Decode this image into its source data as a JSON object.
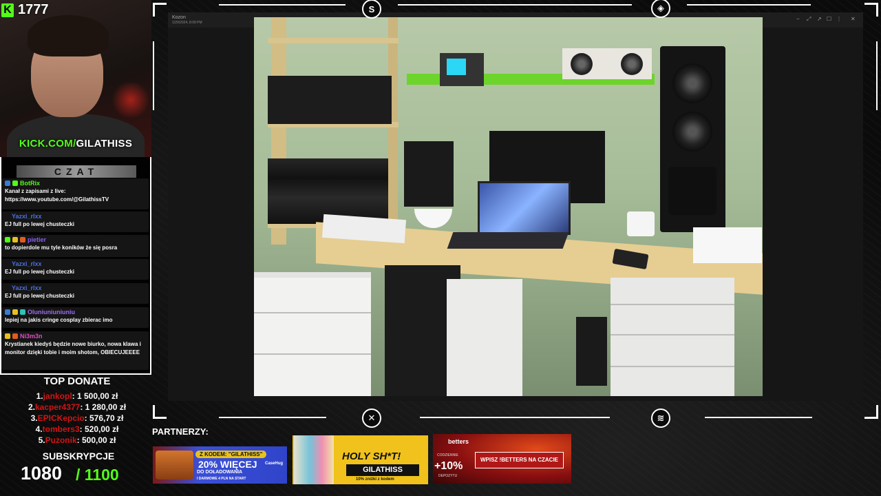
{
  "webcam": {
    "kick_counter": "1777",
    "kick_icon": "K",
    "url_prefix": "KICK.COM/",
    "url_name": "GILATHISS"
  },
  "chat": {
    "title": "CZAT",
    "messages": [
      {
        "user": "BotRix",
        "color": "#53fc18",
        "text": "Kanał z zapisami z live: https://www.youtube.com/@GilathissTV"
      },
      {
        "user": "Yazxi_rlxx",
        "color": "#4a6fe0",
        "text": "EJ full po lewej chusteczki"
      },
      {
        "user": "pietier",
        "color": "#8b5cf6",
        "text": "to dopierdole mu tyle koników że się posra"
      },
      {
        "user": "Yazxi_rlxx",
        "color": "#4a6fe0",
        "text": "EJ full po lewej chusteczki"
      },
      {
        "user": "Yazxi_rlxx",
        "color": "#4a6fe0",
        "text": "EJ full po lewej chusteczki"
      },
      {
        "user": "Oluniuniuniuniu",
        "color": "#9a6cf0",
        "text": "lepiej na jakis cringe cosplay zbierac imo"
      },
      {
        "user": "Ni3m3n",
        "color": "#e04cc0",
        "text": "Krystianek kiedyś będzie nowe biurko, nowa klawa i monitor dzięki tobie i moim shotom, OBIECUJEEEE"
      }
    ]
  },
  "top_donate": {
    "title": "TOP DONATE",
    "entries": [
      {
        "rank": "1.",
        "name": "jankopl",
        "amount": ": 1 500,00 zł"
      },
      {
        "rank": "2.",
        "name": "kacper4377",
        "amount": ": 1 280,00 zł"
      },
      {
        "rank": "3.",
        "name": "EPICKepcio",
        "amount": ": 576,70 zł"
      },
      {
        "rank": "4.",
        "name": "tombers3",
        "amount": ": 520,00 zł"
      },
      {
        "rank": "5.",
        "name": "Puzonik",
        "amount": ": 500,00 zł"
      }
    ]
  },
  "subs": {
    "title": "SUBSKRYPCJE",
    "count": "1080",
    "goal": "/ 1100"
  },
  "screen": {
    "window_title": "Kozon",
    "window_date": "1/20/2024, 8:09 PM",
    "controls": [
      "−",
      "⤢",
      "↗",
      "☐",
      "⋮",
      "✕"
    ]
  },
  "partners": {
    "label": "PARTNERZY:",
    "casehug": {
      "code": "Z KODEM: \"GILATHISS\"",
      "main": "20% WIĘCEJ",
      "sub": "DO DOŁADOWANIA",
      "sub2": "I DARMOWE 4 PLN NA START",
      "logo": "CaseHug"
    },
    "holy": {
      "title": "HOLY SH*T!",
      "code": "GILATHISS",
      "sub": "10% zniżki z kodem"
    },
    "betters": {
      "logo": "betters",
      "small": "CODZIENNIE",
      "pct": "+10%",
      "dep": "DEPOZYTU",
      "cta": "WPISZ !BETTERS NA CZACIE"
    }
  },
  "colors": {
    "kick_green": "#53fc18",
    "donor_red": "#d11515",
    "frame": "#ffffff"
  },
  "icons": [
    "streamer-logo-icon",
    "compass-icon",
    "globe-icon",
    "brand-badge-icon"
  ]
}
